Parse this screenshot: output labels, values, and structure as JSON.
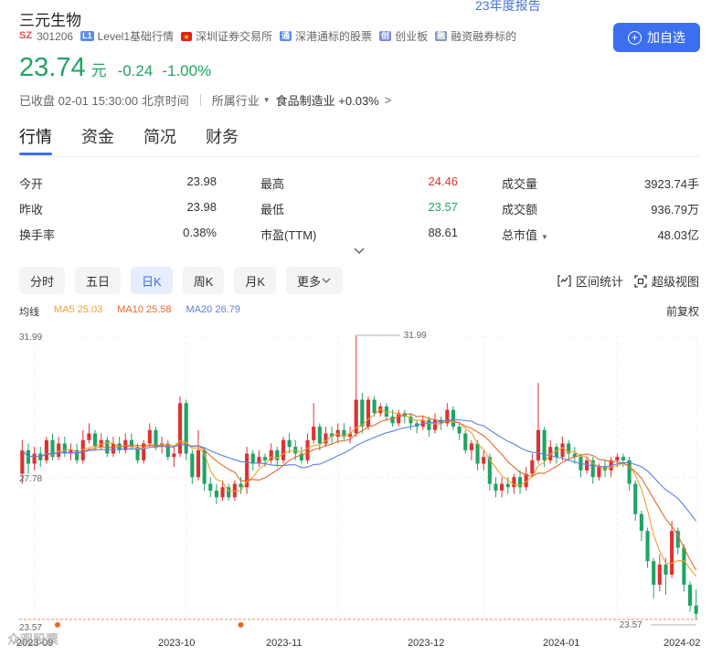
{
  "top_link": "23年度报告",
  "stock": {
    "name": "三元生物",
    "market_badge": "SZ",
    "code": "301206",
    "tags": [
      {
        "badge": "L1",
        "text": "Level1基础行情"
      },
      {
        "badge": "深",
        "text": "深圳证券交易所"
      },
      {
        "badge": "通",
        "text": "深港通标的股票"
      },
      {
        "badge": "创",
        "text": "创业板"
      },
      {
        "badge": "融",
        "text": "融资融券标的"
      }
    ],
    "add_button": "加自选",
    "price": "23.74",
    "unit": "元",
    "change": "-0.24",
    "change_pct": "-1.00%",
    "status": "已收盘 02-01 15:30:00 北京时间",
    "industry_label": "所属行业",
    "industry_name": "食品制造业",
    "industry_change": "+0.03%"
  },
  "tabs": [
    "行情",
    "资金",
    "简况",
    "财务"
  ],
  "stats": [
    [
      {
        "label": "今开",
        "value": "23.98"
      },
      {
        "label": "最高",
        "value": "24.46",
        "color": "red"
      },
      {
        "label": "成交量",
        "value": "3923.74手"
      }
    ],
    [
      {
        "label": "昨收",
        "value": "23.98"
      },
      {
        "label": "最低",
        "value": "23.57",
        "color": "green"
      },
      {
        "label": "成交额",
        "value": "936.79万"
      }
    ],
    [
      {
        "label": "换手率",
        "value": "0.38%"
      },
      {
        "label": "市盈(TTM)",
        "value": "88.61"
      },
      {
        "label": "总市值",
        "value": "48.03亿"
      }
    ]
  ],
  "periods": [
    "分时",
    "五日",
    "日K",
    "周K",
    "月K",
    "更多"
  ],
  "active_period": "日K",
  "tools": [
    "区间统计",
    "超级视图"
  ],
  "ma": {
    "label": "均线",
    "ma5": "MA5 25.03",
    "ma10": "MA10 25.58",
    "ma20": "MA20 26.79"
  },
  "adjust": "前复权",
  "watermark": "众观股票",
  "colors": {
    "up": "#e03131",
    "down": "#1fa463",
    "accent": "#3b6ff0",
    "ma5": "#f0a030",
    "ma10": "#e8682a",
    "ma20": "#5b7fe0"
  },
  "chart_data": {
    "type": "candlestick",
    "y_ticks": [
      "31.99",
      "27.78",
      "23.57"
    ],
    "ylim": [
      23.57,
      31.99
    ],
    "x_ticks": [
      "2023-09",
      "2023-10",
      "2023-11",
      "2023-12",
      "2024-01",
      "2024-02"
    ],
    "high_marker": "31.99",
    "low_marker": "23.57",
    "candles": [
      [
        27.9,
        28.6,
        27.6,
        28.9
      ],
      [
        28.6,
        28.2,
        27.9,
        28.8
      ],
      [
        28.2,
        28.5,
        28.0,
        28.7
      ],
      [
        28.5,
        28.3,
        28.1,
        28.7
      ],
      [
        28.3,
        28.9,
        28.2,
        29.0
      ],
      [
        28.9,
        28.4,
        28.3,
        29.1
      ],
      [
        28.4,
        28.8,
        28.3,
        29.0
      ],
      [
        28.8,
        28.5,
        28.4,
        29.0
      ],
      [
        28.5,
        28.6,
        28.3,
        28.8
      ],
      [
        28.6,
        28.3,
        28.2,
        28.8
      ],
      [
        28.3,
        28.9,
        28.2,
        29.2
      ],
      [
        28.9,
        29.1,
        28.8,
        29.4
      ],
      [
        29.1,
        28.7,
        28.6,
        29.2
      ],
      [
        28.7,
        28.9,
        28.6,
        29.1
      ],
      [
        28.9,
        28.5,
        28.4,
        29.0
      ],
      [
        28.5,
        28.8,
        28.4,
        29.0
      ],
      [
        28.8,
        28.6,
        28.5,
        29.0
      ],
      [
        28.6,
        28.9,
        28.5,
        29.1
      ],
      [
        28.9,
        28.7,
        28.6,
        29.1
      ],
      [
        28.7,
        28.3,
        28.2,
        28.8
      ],
      [
        28.3,
        28.8,
        28.2,
        28.9
      ],
      [
        28.8,
        29.2,
        28.7,
        29.4
      ],
      [
        29.2,
        28.7,
        28.6,
        29.3
      ],
      [
        28.7,
        28.8,
        28.5,
        29.0
      ],
      [
        28.8,
        28.4,
        28.3,
        28.9
      ],
      [
        28.4,
        28.5,
        28.1,
        28.7
      ],
      [
        28.5,
        30.0,
        28.4,
        30.2
      ],
      [
        30.0,
        28.5,
        28.3,
        30.1
      ],
      [
        28.5,
        27.8,
        27.6,
        28.6
      ],
      [
        27.8,
        28.6,
        27.7,
        29.2
      ],
      [
        28.6,
        27.6,
        27.4,
        28.7
      ],
      [
        27.6,
        27.4,
        27.2,
        27.8
      ],
      [
        27.4,
        27.2,
        27.0,
        27.6
      ],
      [
        27.2,
        27.5,
        27.1,
        27.7
      ],
      [
        27.5,
        27.2,
        27.1,
        27.6
      ],
      [
        27.2,
        27.6,
        27.1,
        27.7
      ],
      [
        27.6,
        27.5,
        27.3,
        27.8
      ],
      [
        27.5,
        28.5,
        27.3,
        28.7
      ],
      [
        28.5,
        28.2,
        28.0,
        28.6
      ],
      [
        28.2,
        28.4,
        28.1,
        28.6
      ],
      [
        28.4,
        28.3,
        28.1,
        28.5
      ],
      [
        28.3,
        28.6,
        28.2,
        28.8
      ],
      [
        28.6,
        28.3,
        28.1,
        28.7
      ],
      [
        28.3,
        28.9,
        28.2,
        29.0
      ],
      [
        28.9,
        28.7,
        28.5,
        29.1
      ],
      [
        28.7,
        28.5,
        28.3,
        28.9
      ],
      [
        28.5,
        28.3,
        28.2,
        28.7
      ],
      [
        28.3,
        28.9,
        28.2,
        29.1
      ],
      [
        28.9,
        29.3,
        28.8,
        30.0
      ],
      [
        29.3,
        28.8,
        28.6,
        29.4
      ],
      [
        28.8,
        29.1,
        28.7,
        29.3
      ],
      [
        29.1,
        29.0,
        28.8,
        29.3
      ],
      [
        29.0,
        29.2,
        28.8,
        29.4
      ],
      [
        29.2,
        29.0,
        28.9,
        29.4
      ],
      [
        29.0,
        29.1,
        28.8,
        29.3
      ],
      [
        29.1,
        30.1,
        29.0,
        31.99
      ],
      [
        30.1,
        29.3,
        29.1,
        30.3
      ],
      [
        29.3,
        30.1,
        29.2,
        30.2
      ],
      [
        30.1,
        29.7,
        29.6,
        30.2
      ],
      [
        29.7,
        29.9,
        29.6,
        30.0
      ],
      [
        29.9,
        29.6,
        29.5,
        30.0
      ],
      [
        29.6,
        29.4,
        29.3,
        29.8
      ],
      [
        29.4,
        29.7,
        29.3,
        29.8
      ],
      [
        29.7,
        29.6,
        29.4,
        29.8
      ],
      [
        29.6,
        29.4,
        29.2,
        29.7
      ],
      [
        29.4,
        29.3,
        29.1,
        29.5
      ],
      [
        29.3,
        29.5,
        29.2,
        29.6
      ],
      [
        29.5,
        29.2,
        29.0,
        29.6
      ],
      [
        29.2,
        29.5,
        29.1,
        29.7
      ],
      [
        29.5,
        29.4,
        29.2,
        29.6
      ],
      [
        29.4,
        29.8,
        29.3,
        30.0
      ],
      [
        29.8,
        29.3,
        29.2,
        29.9
      ],
      [
        29.3,
        29.1,
        28.9,
        29.4
      ],
      [
        29.1,
        28.6,
        28.5,
        29.2
      ],
      [
        28.6,
        28.8,
        28.3,
        28.9
      ],
      [
        28.8,
        28.2,
        28.0,
        28.9
      ],
      [
        28.2,
        28.4,
        28.0,
        28.6
      ],
      [
        28.4,
        27.6,
        27.4,
        28.5
      ],
      [
        27.6,
        27.4,
        27.2,
        27.8
      ],
      [
        27.4,
        27.6,
        27.2,
        27.8
      ],
      [
        27.6,
        27.5,
        27.3,
        27.8
      ],
      [
        27.5,
        27.8,
        27.3,
        27.9
      ],
      [
        27.8,
        27.5,
        27.3,
        28.0
      ],
      [
        27.5,
        27.9,
        27.4,
        28.1
      ],
      [
        27.9,
        28.3,
        27.8,
        28.5
      ],
      [
        28.3,
        29.2,
        28.2,
        30.6
      ],
      [
        29.2,
        28.3,
        28.1,
        29.3
      ],
      [
        28.3,
        28.7,
        28.2,
        28.9
      ],
      [
        28.7,
        28.4,
        28.2,
        28.8
      ],
      [
        28.4,
        28.8,
        28.3,
        29.0
      ],
      [
        28.8,
        28.5,
        28.3,
        28.9
      ],
      [
        28.5,
        28.4,
        28.2,
        28.7
      ],
      [
        28.4,
        28.0,
        27.8,
        28.5
      ],
      [
        28.0,
        28.3,
        27.9,
        28.4
      ],
      [
        28.3,
        27.8,
        27.6,
        28.4
      ],
      [
        27.8,
        28.1,
        27.7,
        28.2
      ],
      [
        28.1,
        28.0,
        27.8,
        28.3
      ],
      [
        28.0,
        28.3,
        27.8,
        28.4
      ],
      [
        28.3,
        28.4,
        28.1,
        28.5
      ],
      [
        28.4,
        28.3,
        28.1,
        28.5
      ],
      [
        28.3,
        27.6,
        27.4,
        28.4
      ],
      [
        27.6,
        26.7,
        26.5,
        27.7
      ],
      [
        26.7,
        26.2,
        25.9,
        26.8
      ],
      [
        26.2,
        25.3,
        25.1,
        26.3
      ],
      [
        25.3,
        24.6,
        24.2,
        25.4
      ],
      [
        24.6,
        25.2,
        24.4,
        25.5
      ],
      [
        25.2,
        24.9,
        24.3,
        25.4
      ],
      [
        24.9,
        26.2,
        24.8,
        26.5
      ],
      [
        26.2,
        25.7,
        25.5,
        26.3
      ],
      [
        25.7,
        24.6,
        24.4,
        25.8
      ],
      [
        24.6,
        23.98,
        23.8,
        24.7
      ],
      [
        23.98,
        23.74,
        23.57,
        24.46
      ]
    ]
  }
}
